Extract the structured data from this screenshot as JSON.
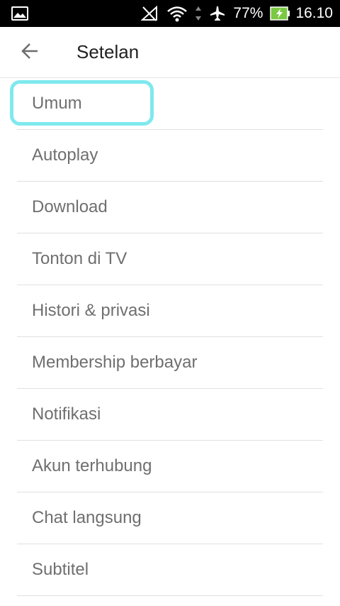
{
  "status_bar": {
    "battery_percent": "77%",
    "time": "16.10",
    "icons": [
      "gallery-icon",
      "no-signal-icon",
      "wifi-icon",
      "data-arrows-icon",
      "airplane-icon",
      "battery-charging-icon"
    ],
    "battery_color": "#7ac943"
  },
  "app_bar": {
    "title": "Setelan",
    "back_icon": "arrow-left-icon"
  },
  "settings": {
    "items": [
      {
        "label": "Umum"
      },
      {
        "label": "Autoplay"
      },
      {
        "label": "Download"
      },
      {
        "label": "Tonton di TV"
      },
      {
        "label": "Histori & privasi"
      },
      {
        "label": "Membership berbayar"
      },
      {
        "label": "Notifikasi"
      },
      {
        "label": "Akun terhubung"
      },
      {
        "label": "Chat langsung"
      },
      {
        "label": "Subtitel"
      }
    ]
  },
  "highlight_color": "#7ee9ee"
}
